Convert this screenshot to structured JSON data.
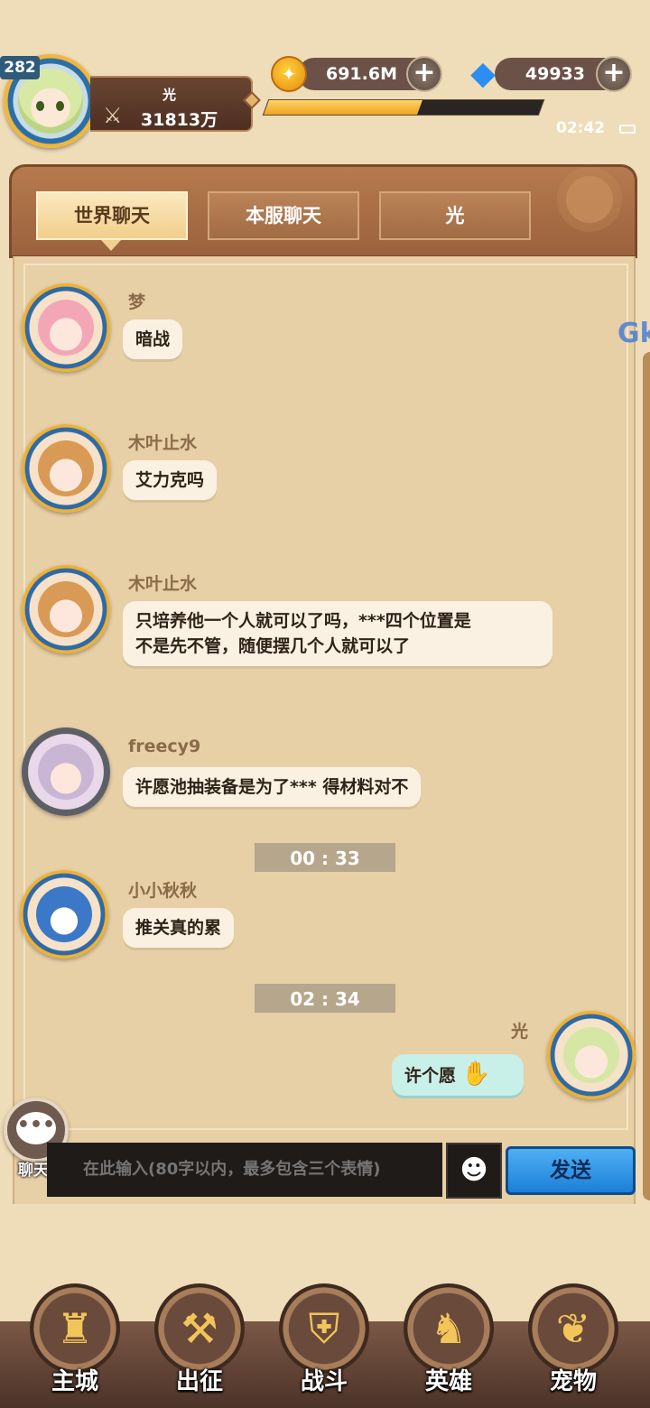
{
  "player": {
    "level": "282",
    "name": "光",
    "power": "31813万",
    "exp_progress": 0.56
  },
  "currencies": {
    "gold": "691.6M",
    "gems": "49933"
  },
  "status": {
    "time": "02:42"
  },
  "tabs": [
    {
      "label": "世界聊天",
      "active": true
    },
    {
      "label": "本服聊天",
      "active": false
    },
    {
      "label": "光",
      "active": false
    }
  ],
  "side_text": "Gk",
  "messages": [
    {
      "sender": "梦",
      "text": "暗战",
      "avatar": "pink-hair-avatar"
    },
    {
      "sender": "木叶止水",
      "text": "艾力克吗",
      "avatar": "brown-hair-avatar"
    },
    {
      "sender": "木叶止水",
      "text_line1": "只培养他一个人就可以了吗，***四个位置是",
      "text_line2": "不是先不管，随便摆几个人就可以了",
      "avatar": "brown-hair-avatar"
    },
    {
      "sender": "freecy9",
      "text": "许愿池抽装备是为了*** 得材料对不",
      "avatar": "cat-hood-avatar"
    },
    {
      "sender": "小小秋秋",
      "text": "推关真的累",
      "avatar": "shark-avatar"
    },
    {
      "sender": "光",
      "text": "许个愿",
      "avatar": "green-hair-avatar",
      "mine": true
    }
  ],
  "time_separators": [
    "00 : 33",
    "02 : 34"
  ],
  "input": {
    "chat_label": "聊天",
    "placeholder": "在此输入(80字以内，最多包含三个表情)",
    "send_label": "发送"
  },
  "nav": [
    {
      "label": "主城",
      "icon": "castle-icon"
    },
    {
      "label": "出征",
      "icon": "crossed-axes-icon"
    },
    {
      "label": "战斗",
      "icon": "battle-shield-icon"
    },
    {
      "label": "英雄",
      "icon": "hooded-hero-icon"
    },
    {
      "label": "宠物",
      "icon": "dragon-head-icon"
    }
  ]
}
